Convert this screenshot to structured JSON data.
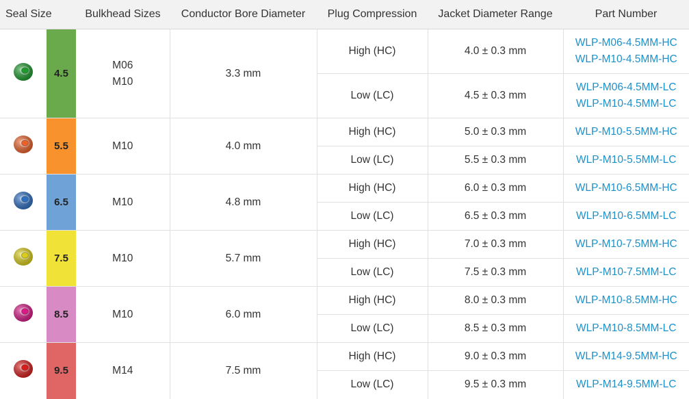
{
  "headers": {
    "seal_size": "Seal Size",
    "bulkhead_sizes": "Bulkhead Sizes",
    "conductor_bore": "Conductor Bore Diameter",
    "plug_compression": "Plug Compression",
    "jacket_range": "Jacket Diameter Range",
    "part_number": "Part Number"
  },
  "rows": [
    {
      "size": "4.5",
      "color": "#6aaa4c",
      "icon": "green-seal-ring-icon",
      "ring_color": "#1e9a2e",
      "bulkhead": [
        "M06",
        "M10"
      ],
      "bore": "3.3 mm",
      "variants": [
        {
          "compression": "High (HC)",
          "jacket": "4.0 ± 0.3 mm",
          "parts": [
            "WLP-M06-4.5MM-HC",
            "WLP-M10-4.5MM-HC"
          ]
        },
        {
          "compression": "Low (LC)",
          "jacket": "4.5 ± 0.3 mm",
          "parts": [
            "WLP-M06-4.5MM-LC",
            "WLP-M10-4.5MM-LC"
          ]
        }
      ]
    },
    {
      "size": "5.5",
      "color": "#f7922d",
      "icon": "orange-seal-ring-icon",
      "ring_color": "#e8622a",
      "bulkhead": [
        "M10"
      ],
      "bore": "4.0 mm",
      "variants": [
        {
          "compression": "High (HC)",
          "jacket": "5.0 ± 0.3 mm",
          "parts": [
            "WLP-M10-5.5MM-HC"
          ]
        },
        {
          "compression": "Low (LC)",
          "jacket": "5.5 ± 0.3 mm",
          "parts": [
            "WLP-M10-5.5MM-LC"
          ]
        }
      ]
    },
    {
      "size": "6.5",
      "color": "#6fa3d8",
      "icon": "blue-seal-ring-icon",
      "ring_color": "#2f6fc0",
      "bulkhead": [
        "M10"
      ],
      "bore": "4.8 mm",
      "variants": [
        {
          "compression": "High (HC)",
          "jacket": "6.0 ± 0.3 mm",
          "parts": [
            "WLP-M10-6.5MM-HC"
          ]
        },
        {
          "compression": "Low (LC)",
          "jacket": "6.5 ± 0.3 mm",
          "parts": [
            "WLP-M10-6.5MM-LC"
          ]
        }
      ]
    },
    {
      "size": "7.5",
      "color": "#f0e236",
      "icon": "yellow-seal-ring-icon",
      "ring_color": "#d8cc1c",
      "bulkhead": [
        "M10"
      ],
      "bore": "5.7 mm",
      "variants": [
        {
          "compression": "High (HC)",
          "jacket": "7.0 ± 0.3 mm",
          "parts": [
            "WLP-M10-7.5MM-HC"
          ]
        },
        {
          "compression": "Low (LC)",
          "jacket": "7.5 ± 0.3 mm",
          "parts": [
            "WLP-M10-7.5MM-LC"
          ]
        }
      ]
    },
    {
      "size": "8.5",
      "color": "#d88ac4",
      "icon": "pink-seal-ring-icon",
      "ring_color": "#d61a86",
      "bulkhead": [
        "M10"
      ],
      "bore": "6.0 mm",
      "variants": [
        {
          "compression": "High (HC)",
          "jacket": "8.0 ± 0.3 mm",
          "parts": [
            "WLP-M10-8.5MM-HC"
          ]
        },
        {
          "compression": "Low (LC)",
          "jacket": "8.5 ± 0.3 mm",
          "parts": [
            "WLP-M10-8.5MM-LC"
          ]
        }
      ]
    },
    {
      "size": "9.5",
      "color": "#e06666",
      "icon": "red-seal-ring-icon",
      "ring_color": "#d61e1e",
      "bulkhead": [
        "M14"
      ],
      "bore": "7.5 mm",
      "variants": [
        {
          "compression": "High (HC)",
          "jacket": "9.0 ± 0.3 mm",
          "parts": [
            "WLP-M14-9.5MM-HC"
          ]
        },
        {
          "compression": "Low (LC)",
          "jacket": "9.5 ± 0.3 mm",
          "parts": [
            "WLP-M14-9.5MM-LC"
          ]
        }
      ]
    }
  ]
}
